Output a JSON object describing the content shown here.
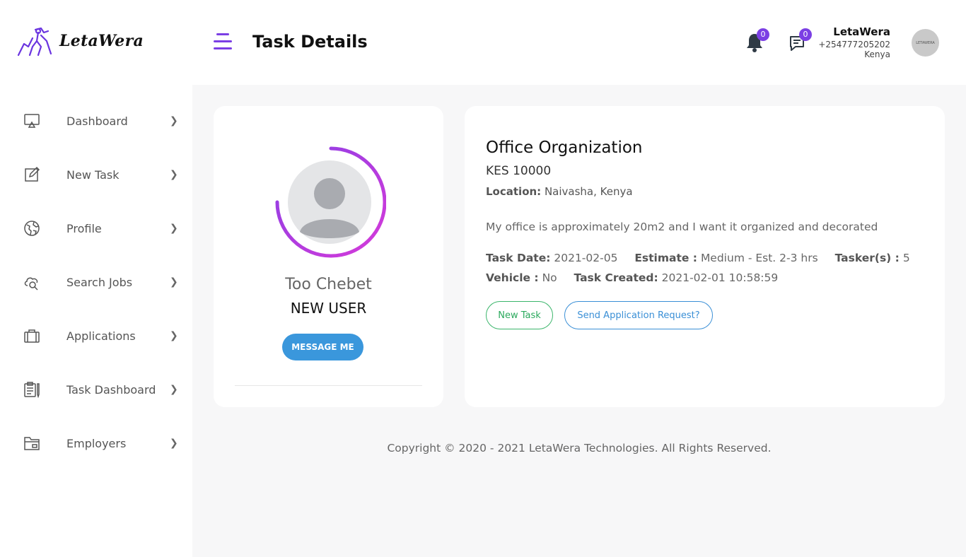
{
  "brand": {
    "name": "LetaWera",
    "accent": "#7b3fe4"
  },
  "header": {
    "page_title": "Task Details",
    "notifications_count": "0",
    "messages_count": "0",
    "user": {
      "name": "LetaWera",
      "phone": "+254777205202",
      "country": "Kenya",
      "avatar_text": "LETAWERA"
    }
  },
  "sidebar": {
    "items": [
      {
        "label": "Dashboard",
        "icon": "monitor-icon"
      },
      {
        "label": "New Task",
        "icon": "edit-icon"
      },
      {
        "label": "Profile",
        "icon": "globe-icon"
      },
      {
        "label": "Search Jobs",
        "icon": "cloud-search-icon"
      },
      {
        "label": "Applications",
        "icon": "briefcase-icon"
      },
      {
        "label": "Task Dashboard",
        "icon": "clipboard-icon"
      },
      {
        "label": "Employers",
        "icon": "folder-icon"
      }
    ]
  },
  "profile_card": {
    "name": "Too Chebet",
    "role": "NEW USER",
    "message_button": "MESSAGE ME"
  },
  "task": {
    "title": "Office Organization",
    "price": "KES 10000",
    "location_label": "Location:",
    "location": "Naivasha, Kenya",
    "description": "My office is approximately 20m2 and I want it organized and decorated",
    "task_date_label": "Task Date:",
    "task_date": "2021-02-05",
    "estimate_label": "Estimate :",
    "estimate": "Medium - Est. 2-3 hrs",
    "taskers_label": "Tasker(s) :",
    "taskers": "5",
    "vehicle_label": "Vehicle :",
    "vehicle": "No",
    "created_label": "Task Created:",
    "created": "2021-02-01 10:58:59",
    "new_task_button": "New Task",
    "apply_button": "Send Application Request?"
  },
  "footer": {
    "copyright": "Copyright © 2020 - 2021 LetaWera Technologies. All Rights Reserved."
  }
}
